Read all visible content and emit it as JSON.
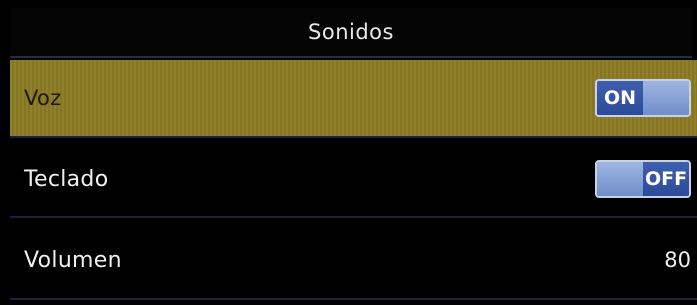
{
  "header": {
    "title": "Sonidos"
  },
  "settings": {
    "voz": {
      "label": "Voz",
      "state": "ON"
    },
    "teclado": {
      "label": "Teclado",
      "state": "OFF"
    },
    "volumen": {
      "label": "Volumen",
      "value": "80"
    }
  },
  "colors": {
    "selected_row": "#8b7a22",
    "toggle_blue": "#3f5fae",
    "background": "#000000"
  }
}
